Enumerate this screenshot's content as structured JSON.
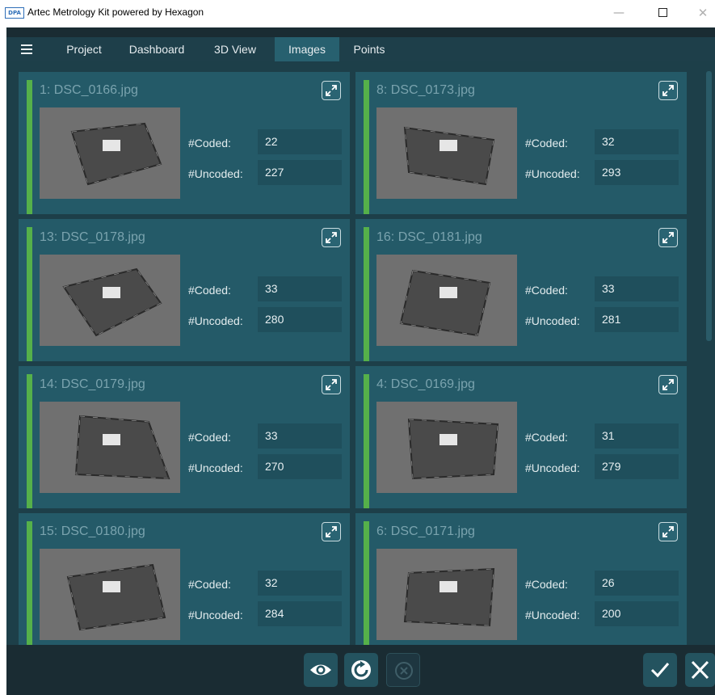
{
  "window": {
    "logo_text": "DPA",
    "title": "Artec Metrology Kit powered by Hexagon",
    "minimize_symbol": "—",
    "close_symbol": "✕"
  },
  "tabs": [
    {
      "label": "Project",
      "active": false
    },
    {
      "label": "Dashboard",
      "active": false
    },
    {
      "label": "3D View",
      "active": false
    },
    {
      "label": "Images",
      "active": true
    },
    {
      "label": "Points",
      "active": false
    }
  ],
  "labels": {
    "coded": "#Coded:",
    "uncoded": "#Uncoded:"
  },
  "images": [
    {
      "name": "1: DSC_0166.jpg",
      "coded": "22",
      "uncoded": "227",
      "status": "ok"
    },
    {
      "name": "8: DSC_0173.jpg",
      "coded": "32",
      "uncoded": "293",
      "status": "ok"
    },
    {
      "name": "13: DSC_0178.jpg",
      "coded": "33",
      "uncoded": "280",
      "status": "ok"
    },
    {
      "name": "16: DSC_0181.jpg",
      "coded": "33",
      "uncoded": "281",
      "status": "ok"
    },
    {
      "name": "14: DSC_0179.jpg",
      "coded": "33",
      "uncoded": "270",
      "status": "ok"
    },
    {
      "name": "4: DSC_0169.jpg",
      "coded": "31",
      "uncoded": "279",
      "status": "ok"
    },
    {
      "name": "15: DSC_0180.jpg",
      "coded": "32",
      "uncoded": "284",
      "status": "ok"
    },
    {
      "name": "6: DSC_0171.jpg",
      "coded": "26",
      "uncoded": "200",
      "status": "ok"
    }
  ],
  "toolbar": {
    "buttons": [
      {
        "icon": "eye-icon",
        "enabled": true
      },
      {
        "icon": "refresh-icon",
        "enabled": true
      },
      {
        "icon": "cancel-circle-icon",
        "enabled": false
      },
      {
        "icon": "checkmark-icon",
        "enabled": true
      },
      {
        "icon": "close-icon",
        "enabled": true
      }
    ]
  },
  "colors": {
    "accent": "#55b04a",
    "background": "#1d3f49",
    "card": "#245a68",
    "active_tab": "#27606f"
  }
}
